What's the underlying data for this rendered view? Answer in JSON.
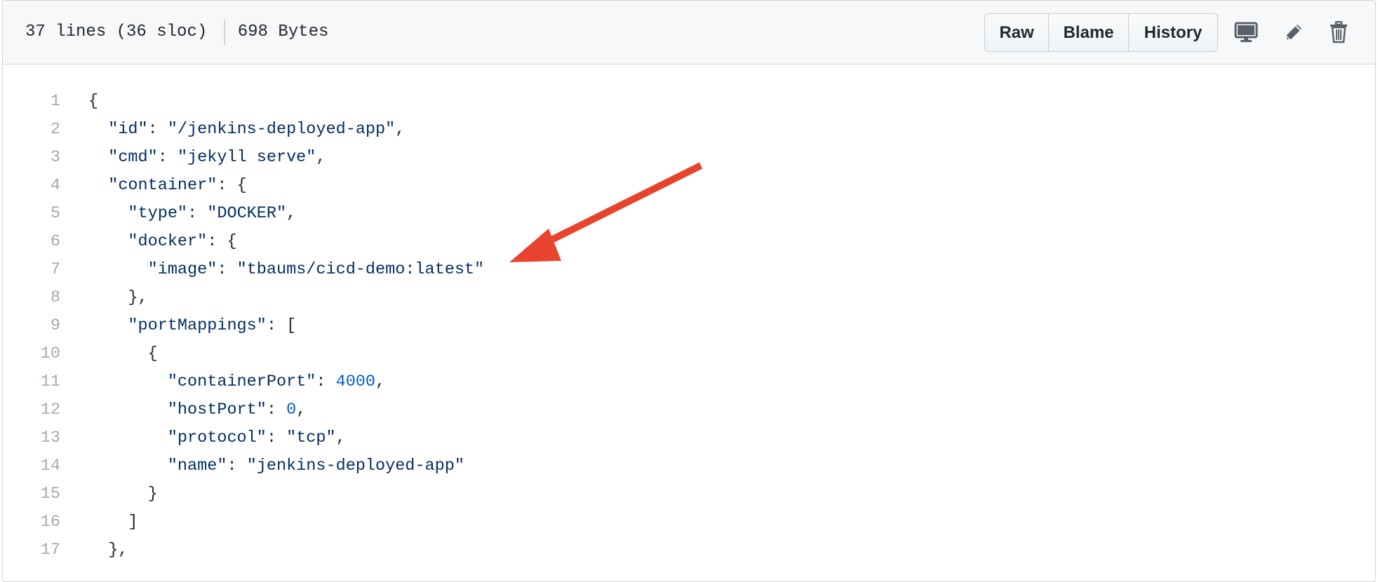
{
  "file_header": {
    "lines_info": "37 lines (36 sloc)",
    "size": "698 Bytes",
    "buttons": {
      "raw": "Raw",
      "blame": "Blame",
      "history": "History"
    },
    "icons": [
      "desktop-icon",
      "pencil-icon",
      "trash-icon"
    ]
  },
  "code": {
    "lines": [
      {
        "num": "1",
        "parts": [
          {
            "t": "p",
            "v": "{"
          }
        ]
      },
      {
        "num": "2",
        "parts": [
          {
            "t": "p",
            "v": "  "
          },
          {
            "t": "s",
            "v": "\"id\""
          },
          {
            "t": "p",
            "v": ": "
          },
          {
            "t": "s",
            "v": "\"/jenkins-deployed-app\""
          },
          {
            "t": "p",
            "v": ","
          }
        ]
      },
      {
        "num": "3",
        "parts": [
          {
            "t": "p",
            "v": "  "
          },
          {
            "t": "s",
            "v": "\"cmd\""
          },
          {
            "t": "p",
            "v": ": "
          },
          {
            "t": "s",
            "v": "\"jekyll serve\""
          },
          {
            "t": "p",
            "v": ","
          }
        ]
      },
      {
        "num": "4",
        "parts": [
          {
            "t": "p",
            "v": "  "
          },
          {
            "t": "s",
            "v": "\"container\""
          },
          {
            "t": "p",
            "v": ": {"
          }
        ]
      },
      {
        "num": "5",
        "parts": [
          {
            "t": "p",
            "v": "    "
          },
          {
            "t": "s",
            "v": "\"type\""
          },
          {
            "t": "p",
            "v": ": "
          },
          {
            "t": "s",
            "v": "\"DOCKER\""
          },
          {
            "t": "p",
            "v": ","
          }
        ]
      },
      {
        "num": "6",
        "parts": [
          {
            "t": "p",
            "v": "    "
          },
          {
            "t": "s",
            "v": "\"docker\""
          },
          {
            "t": "p",
            "v": ": {"
          }
        ]
      },
      {
        "num": "7",
        "parts": [
          {
            "t": "p",
            "v": "      "
          },
          {
            "t": "s",
            "v": "\"image\""
          },
          {
            "t": "p",
            "v": ": "
          },
          {
            "t": "s",
            "v": "\"tbaums/cicd-demo:latest\""
          }
        ]
      },
      {
        "num": "8",
        "parts": [
          {
            "t": "p",
            "v": "    },"
          }
        ]
      },
      {
        "num": "9",
        "parts": [
          {
            "t": "p",
            "v": "    "
          },
          {
            "t": "s",
            "v": "\"portMappings\""
          },
          {
            "t": "p",
            "v": ": ["
          }
        ]
      },
      {
        "num": "10",
        "parts": [
          {
            "t": "p",
            "v": "      {"
          }
        ]
      },
      {
        "num": "11",
        "parts": [
          {
            "t": "p",
            "v": "        "
          },
          {
            "t": "s",
            "v": "\"containerPort\""
          },
          {
            "t": "p",
            "v": ": "
          },
          {
            "t": "n",
            "v": "4000"
          },
          {
            "t": "p",
            "v": ","
          }
        ]
      },
      {
        "num": "12",
        "parts": [
          {
            "t": "p",
            "v": "        "
          },
          {
            "t": "s",
            "v": "\"hostPort\""
          },
          {
            "t": "p",
            "v": ": "
          },
          {
            "t": "n",
            "v": "0"
          },
          {
            "t": "p",
            "v": ","
          }
        ]
      },
      {
        "num": "13",
        "parts": [
          {
            "t": "p",
            "v": "        "
          },
          {
            "t": "s",
            "v": "\"protocol\""
          },
          {
            "t": "p",
            "v": ": "
          },
          {
            "t": "s",
            "v": "\"tcp\""
          },
          {
            "t": "p",
            "v": ","
          }
        ]
      },
      {
        "num": "14",
        "parts": [
          {
            "t": "p",
            "v": "        "
          },
          {
            "t": "s",
            "v": "\"name\""
          },
          {
            "t": "p",
            "v": ": "
          },
          {
            "t": "s",
            "v": "\"jenkins-deployed-app\""
          }
        ]
      },
      {
        "num": "15",
        "parts": [
          {
            "t": "p",
            "v": "      }"
          }
        ]
      },
      {
        "num": "16",
        "parts": [
          {
            "t": "p",
            "v": "    ]"
          }
        ]
      },
      {
        "num": "17",
        "parts": [
          {
            "t": "p",
            "v": "  },"
          }
        ]
      }
    ]
  },
  "annotation": {
    "arrow_color": "#e8432e",
    "points_to_line": "7"
  },
  "colors": {
    "string": "#032f62",
    "number": "#005cc5",
    "punctuation": "#24292e",
    "line_number": "#a3aab1",
    "header_bg": "#f6f8fa",
    "border": "#d1d5da"
  }
}
